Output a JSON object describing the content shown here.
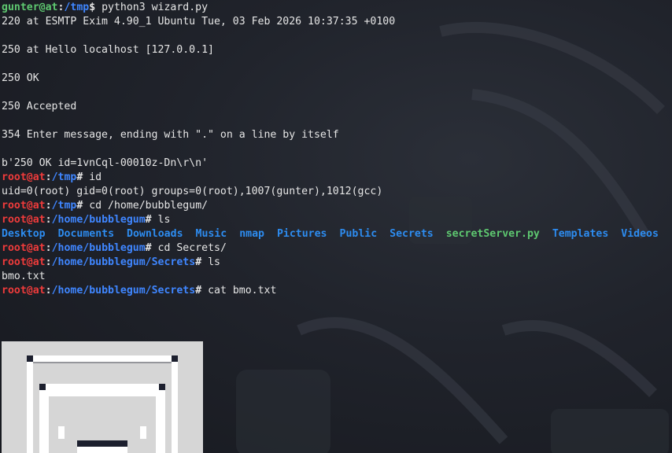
{
  "prompt_styles": {
    "user_color": "#5ec870",
    "root_color": "#ef3b3b",
    "path_color": "#3f86ff",
    "dir_color": "#2d8cf0",
    "exe_color": "#5ec870"
  },
  "session": {
    "p1": {
      "user": "gunter",
      "at": "@",
      "host": "at",
      "colon": ":",
      "path": "/tmp",
      "sym": "$ ",
      "cmd": "python3 wizard.py"
    },
    "o1": "220 at ESMTP Exim 4.90_1 Ubuntu Tue, 03 Feb 2026 10:37:35 +0100",
    "o2": "250 at Hello localhost [127.0.0.1]",
    "o3": "250 OK",
    "o4": "250 Accepted",
    "o5": "354 Enter message, ending with \".\" on a line by itself",
    "o6": "b'250 OK id=1vnCql-00010z-Dn\\r\\n'",
    "p2": {
      "user": "root",
      "at": "@",
      "host": "at",
      "colon": ":",
      "path": "/tmp",
      "sym": "# ",
      "cmd": "id"
    },
    "o7": "uid=0(root) gid=0(root) groups=0(root),1007(gunter),1012(gcc)",
    "p3": {
      "user": "root",
      "at": "@",
      "host": "at",
      "colon": ":",
      "path": "/tmp",
      "sym": "# ",
      "cmd": "cd /home/bubblegum/"
    },
    "p4": {
      "user": "root",
      "at": "@",
      "host": "at",
      "colon": ":",
      "path": "/home/bubblegum",
      "sym": "# ",
      "cmd": "ls"
    },
    "ls1": [
      "Desktop",
      "Documents",
      "Downloads",
      "Music",
      "nmap",
      "Pictures",
      "Public",
      "Secrets",
      "secretServer.py",
      "Templates",
      "Videos"
    ],
    "p5": {
      "user": "root",
      "at": "@",
      "host": "at",
      "colon": ":",
      "path": "/home/bubblegum",
      "sym": "# ",
      "cmd": "cd Secrets/"
    },
    "p6": {
      "user": "root",
      "at": "@",
      "host": "at",
      "colon": ":",
      "path": "/home/bubblegum/Secrets",
      "sym": "# ",
      "cmd": "ls"
    },
    "ls2": [
      "bmo.txt"
    ],
    "p7": {
      "user": "root",
      "at": "@",
      "host": "at",
      "colon": ":",
      "path": "/home/bubblegum/Secrets",
      "sym": "# ",
      "cmd": "cat bmo.txt"
    }
  },
  "bmo_image": {
    "icon": "bmo-ascii-art-image",
    "colors": {
      "bg": "#d6d6d6",
      "outline": "#ffffff",
      "dark": "#1c1f2e"
    }
  }
}
